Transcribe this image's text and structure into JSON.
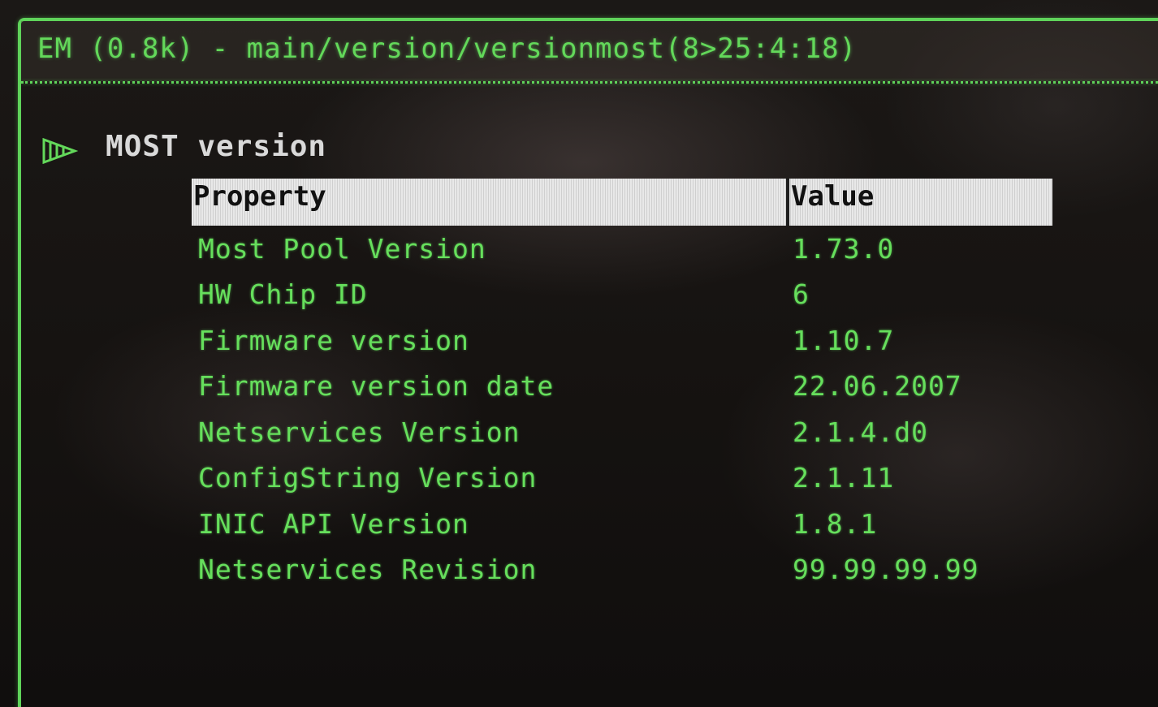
{
  "window": {
    "title": "EM (0.8k) - main/version/versionmost(8>25:4:18)"
  },
  "section": {
    "icon": "play-arrow-icon",
    "title": "MOST version"
  },
  "table": {
    "headers": {
      "property": "Property",
      "value": "Value"
    },
    "rows": [
      {
        "property": "Most Pool Version",
        "value": "1.73.0"
      },
      {
        "property": "HW Chip ID",
        "value": "6"
      },
      {
        "property": "Firmware version",
        "value": "1.10.7"
      },
      {
        "property": "Firmware version date",
        "value": "22.06.2007"
      },
      {
        "property": "Netservices Version",
        "value": "2.1.4.d0"
      },
      {
        "property": "ConfigString Version",
        "value": "2.1.11"
      },
      {
        "property": "INIC API Version",
        "value": "1.8.1"
      },
      {
        "property": "Netservices Revision",
        "value": "99.99.99.99"
      }
    ]
  },
  "colors": {
    "accent_green": "#5fd35a",
    "header_bg": "#e8e8e8"
  }
}
